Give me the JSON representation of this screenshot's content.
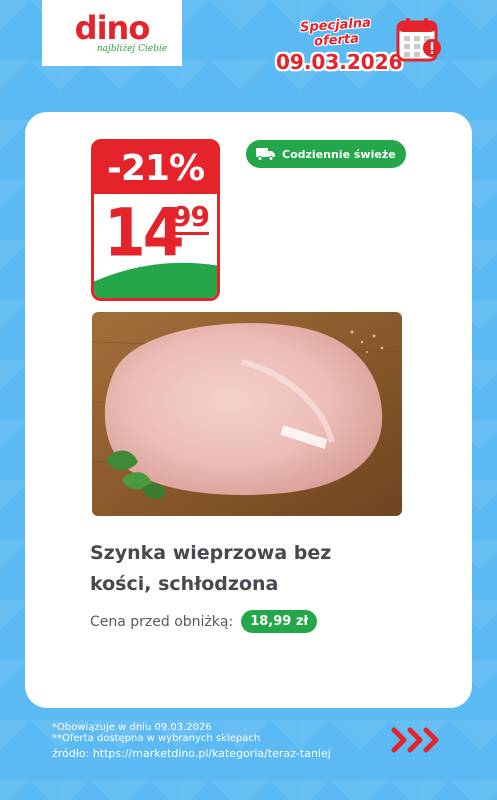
{
  "brand": {
    "name": "dino",
    "tagline": "najbliżej Ciebie",
    "color": "#e5232b",
    "tagline_color": "#2a9d3f"
  },
  "offer": {
    "label": "Specjalna oferta",
    "date": "09.03.2026",
    "icon": "calendar-alert-icon"
  },
  "product": {
    "discount": "-21%",
    "price_int": "14",
    "price_dec": "99",
    "badge": "Codziennie świeże",
    "badge_icon": "delivery-truck-icon",
    "name": "Szynka wieprzowa bez kości, schłodzona",
    "prev_price_label": "Cena przed obniżką:",
    "prev_price": "18,99 zł"
  },
  "footer": {
    "note1": "*Obowiązuje w dniu 09.03.2026",
    "note2": "**Oferta dostępna w wybranych sklepach",
    "source": "źródło: https://marketdino.pl/kategoria/teraz-taniej",
    "arrows_icon": "triple-chevron-right-icon"
  },
  "colors": {
    "background": "#5bbaf3",
    "accent_red": "#e5232b",
    "accent_green": "#24a64b"
  }
}
